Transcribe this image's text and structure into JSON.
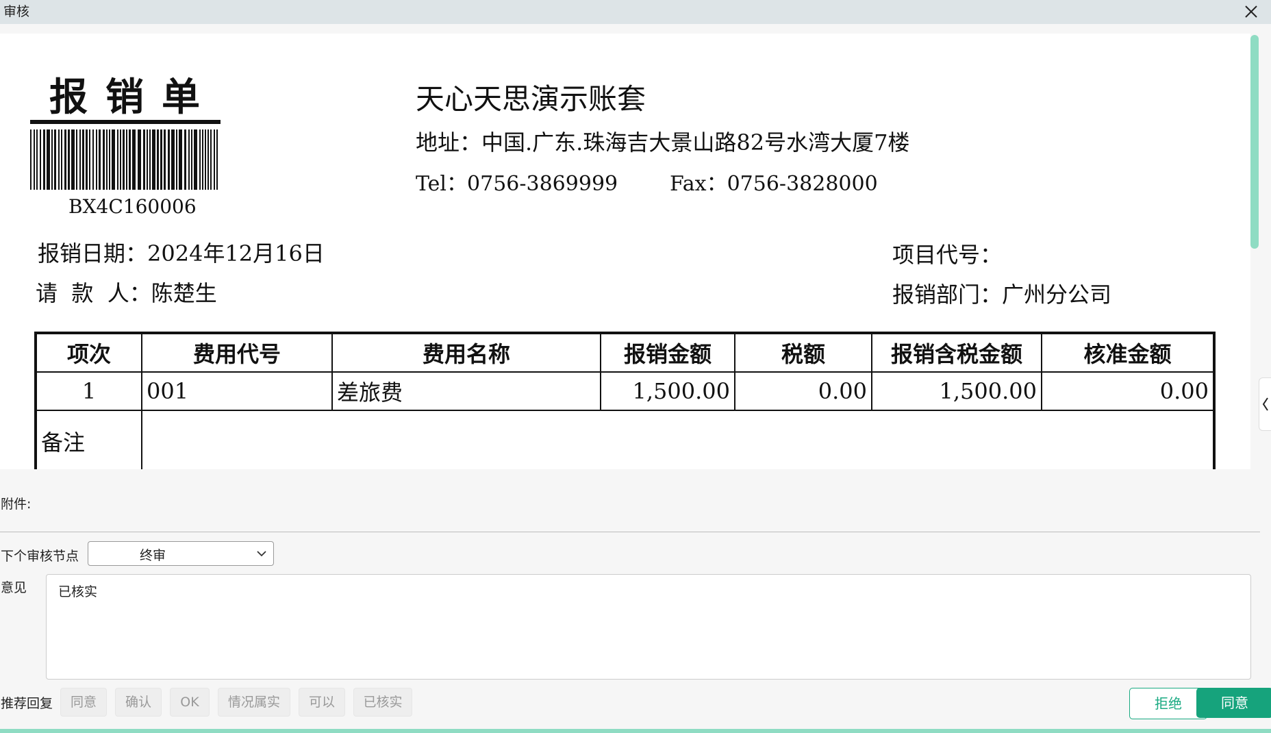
{
  "window": {
    "title": "审核"
  },
  "document": {
    "doc_title": "报销单",
    "barcode_number": "BX4C160006",
    "company": "天心天思演示账套",
    "address": "地址：中国.广东.珠海吉大景山路82号水湾大厦7楼",
    "tel": "Tel：0756-3869999",
    "fax": "Fax：0756-3828000",
    "date_line": "报销日期：2024年12月16日",
    "requester_line": "请  款  人：陈楚生",
    "project_line": "项目代号：",
    "dept_line": "报销部门：广州分公司",
    "table": {
      "headers": [
        "项次",
        "费用代号",
        "费用名称",
        "报销金额",
        "税额",
        "报销含税金额",
        "核准金额"
      ],
      "rows": [
        [
          "1",
          "001",
          "差旅费",
          "1,500.00",
          "0.00",
          "1,500.00",
          "0.00"
        ]
      ],
      "remark_label": "备注"
    }
  },
  "form": {
    "attachment_label": "附件:",
    "next_node_label": "下个审核节点",
    "next_node_value": "终审",
    "opinion_label": "意见",
    "opinion_value": "已核实",
    "suggest_label": "推荐回复",
    "suggestions": [
      "同意",
      "确认",
      "OK",
      "情况属实",
      "可以",
      "已核实"
    ],
    "reject_label": "拒绝",
    "agree_label": "同意"
  },
  "colors": {
    "accent": "#16a37c",
    "scrollbar": "#8fdcc3",
    "titlebar": "#dde4e7"
  }
}
